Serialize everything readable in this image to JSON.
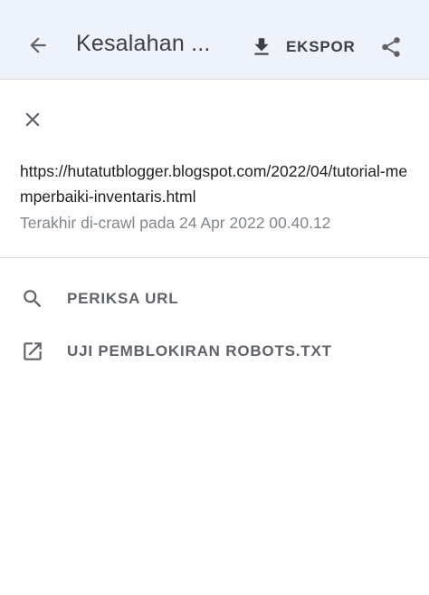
{
  "header": {
    "title": "Kesalahan ...",
    "export_label": "EKSPOR",
    "back_icon": "arrow-back-icon",
    "export_icon": "download-icon",
    "share_icon": "share-icon"
  },
  "panel": {
    "close_icon": "close-icon",
    "url": "https://hutatutblogger.blogspot.com/2022/04/tutorial-memperbaiki-inventaris.html",
    "crawl_info": "Terakhir di-crawl pada 24 Apr 2022 00.40.12"
  },
  "actions": [
    {
      "label": "PERIKSA URL",
      "icon": "search-icon"
    },
    {
      "label": "UJI PEMBLOKIRAN ROBOTS.TXT",
      "icon": "open-in-new-icon"
    }
  ],
  "colors": {
    "header_bg": "#eef3fb",
    "text_primary": "#202124",
    "text_secondary": "#80868b",
    "icon": "#5f6368"
  }
}
